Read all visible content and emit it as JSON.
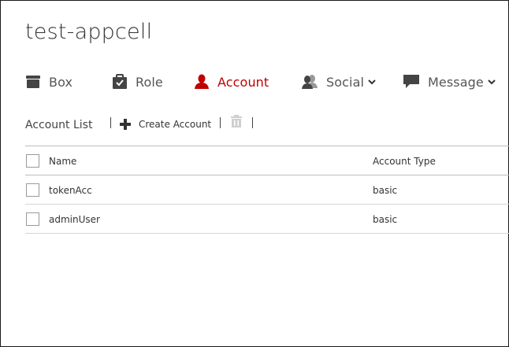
{
  "app": {
    "title": "test-appcell"
  },
  "nav": {
    "tabs": [
      {
        "label": "Box",
        "icon": "box-icon",
        "active": false
      },
      {
        "label": "Role",
        "icon": "briefcase-icon",
        "active": false
      },
      {
        "label": "Account",
        "icon": "user-icon",
        "active": true
      },
      {
        "label": "Social",
        "icon": "users-icon",
        "active": false,
        "dropdown": true
      },
      {
        "label": "Message",
        "icon": "message-icon",
        "active": false,
        "dropdown": true
      }
    ]
  },
  "colors": {
    "accent": "#c00000",
    "text": "#333333",
    "icon": "#444444"
  },
  "toolbar": {
    "title": "Account List",
    "create_label": "Create Account"
  },
  "table": {
    "columns": [
      "Name",
      "Account Type"
    ],
    "rows": [
      {
        "name": "tokenAcc",
        "type": "basic"
      },
      {
        "name": "adminUser",
        "type": "basic"
      }
    ]
  }
}
